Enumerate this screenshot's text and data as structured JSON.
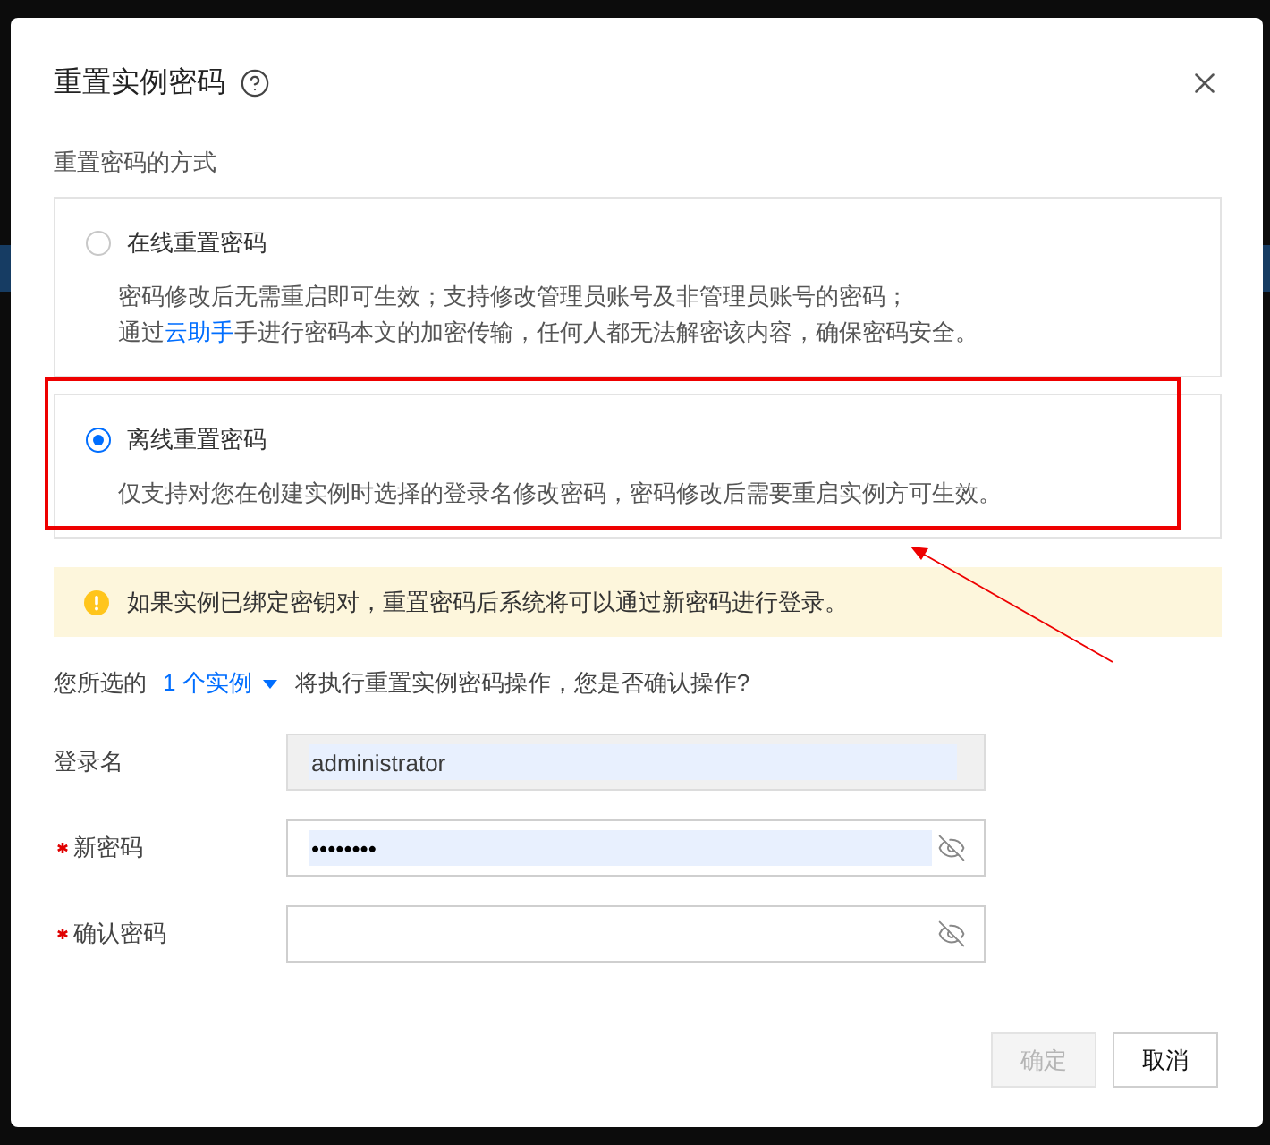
{
  "dialog": {
    "title": "重置实例密码"
  },
  "method": {
    "label": "重置密码的方式",
    "options": [
      {
        "title": "在线重置密码",
        "selected": false,
        "highlighted": false,
        "description": [
          {
            "segments": [
              {
                "kind": "text",
                "text": "密码修改后无需重启即可生效；支持修改管理员账号及非管理员账号的密码；"
              }
            ]
          },
          {
            "segments": [
              {
                "kind": "text",
                "text": "通过"
              },
              {
                "kind": "link",
                "text": "云助手"
              },
              {
                "kind": "text",
                "text": "手进行密码本文的加密传输，任何人都无法解密该内容，确保密码安全。"
              }
            ]
          }
        ]
      },
      {
        "title": "离线重置密码",
        "selected": true,
        "highlighted": true,
        "description": [
          {
            "segments": [
              {
                "kind": "text",
                "text": "仅支持对您在创建实例时选择的登录名修改密码，密码修改后需要重启实例方可生效。"
              }
            ]
          }
        ]
      }
    ]
  },
  "alert": {
    "kind": "warning",
    "text": "如果实例已绑定密钥对，重置密码后系统将可以通过新密码进行登录。"
  },
  "confirmation": {
    "prefix": "您所选的",
    "instances": "1 个实例",
    "suffix": "将执行重置实例密码操作，您是否确认操作?"
  },
  "fields": [
    {
      "label": "登录名",
      "kind": "text",
      "required": false,
      "disabled": true,
      "autofilled": true,
      "value": "administrator"
    },
    {
      "label": "新密码",
      "kind": "password",
      "required": true,
      "disabled": false,
      "autofilled": true,
      "value": "••••••••"
    },
    {
      "label": "确认密码",
      "kind": "password",
      "required": true,
      "disabled": false,
      "autofilled": false
    }
  ],
  "buttons": [
    {
      "label": "确定",
      "kind": "primary",
      "disabled": true
    },
    {
      "label": "取消",
      "kind": "default",
      "disabled": false
    }
  ]
}
